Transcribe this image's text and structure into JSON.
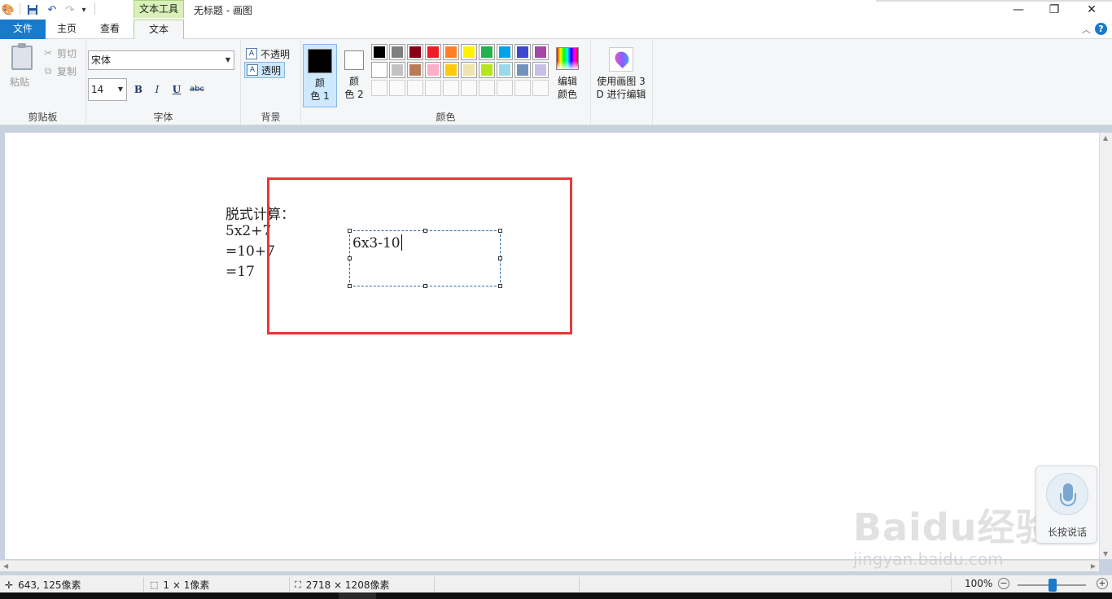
{
  "title": {
    "context_tab": "文本工具",
    "window_title": "无标题 - 画图"
  },
  "tabs": {
    "file": "文件",
    "home": "主页",
    "view": "查看",
    "text": "文本"
  },
  "clipboard": {
    "paste": "粘贴",
    "cut": "剪切",
    "copy": "复制",
    "group": "剪贴板"
  },
  "font": {
    "family": "宋体",
    "size": "14",
    "bold": "B",
    "italic": "I",
    "underline": "U",
    "strike": "abc",
    "group": "字体"
  },
  "background": {
    "opaque": "不透明",
    "transparent": "透明",
    "group": "背景"
  },
  "colors": {
    "color1_line1": "颜",
    "color1_line2": "色 1",
    "color2_line1": "颜",
    "color2_line2": "色 2",
    "color1_value": "#000000",
    "color2_value": "#ffffff",
    "edit_line1": "编辑",
    "edit_line2": "颜色",
    "group": "颜色",
    "palette": [
      "#000000",
      "#7f7f7f",
      "#880015",
      "#ed1c24",
      "#ff7f27",
      "#fff200",
      "#22b14c",
      "#00a2e8",
      "#3f48cc",
      "#a349a4",
      "#ffffff",
      "#c3c3c3",
      "#b97a57",
      "#ffaec9",
      "#ffc90e",
      "#efe4b0",
      "#b5e61d",
      "#99d9ea",
      "#7092be",
      "#c8bfe7"
    ]
  },
  "paint3d": {
    "line1": "使用画图 3",
    "line2": "D 进行编辑"
  },
  "canvas": {
    "lines": [
      "脱式计算：",
      "5x2+7",
      "=10+7",
      "=17"
    ],
    "textbox": "6x3-10"
  },
  "voice": {
    "label": "长按说话"
  },
  "watermark": {
    "logo": "Baidu经验",
    "url": "jingyan.baidu.com"
  },
  "status": {
    "cursor": "643, 125像素",
    "selection": "1 × 1像素",
    "image_size": "2718 × 1208像素",
    "zoom": "100%"
  }
}
